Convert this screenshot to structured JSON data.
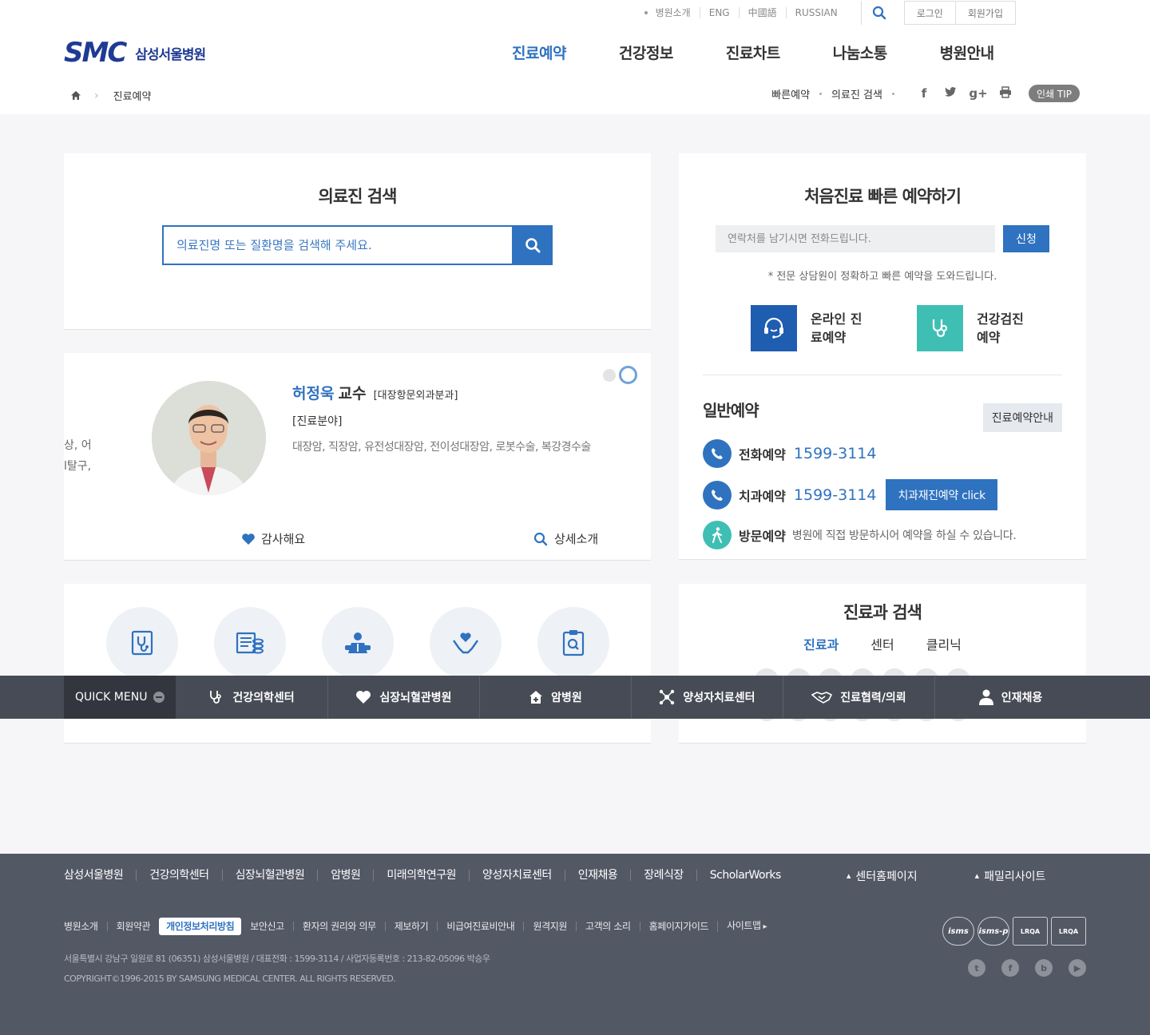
{
  "colors": {
    "accent": "#2f72c0",
    "navy": "#1f3b94",
    "teal": "#3fbfb4",
    "footer": "#535865",
    "quick": "#474b55"
  },
  "header": {
    "lang_links": [
      "병원소개",
      "ENG",
      "中國語",
      "RUSSIAN"
    ],
    "login": "로그인",
    "join": "회원가입",
    "logo_mark": "SMC",
    "logo_name": "삼성서울병원",
    "gnb": [
      "진료예약",
      "건강정보",
      "진료차트",
      "나눔소통",
      "병원안내"
    ],
    "breadcrumb_current": "진료예약",
    "subtools": {
      "quick_res": "빠른예약",
      "doc_search": "의료진 검색",
      "print_tip": "인쇄 TIP",
      "sns": [
        "f",
        "t",
        "g+"
      ]
    }
  },
  "doctor_search": {
    "title": "의료진 검색",
    "placeholder": "의료진명 또는 질환명을 검색해 주세요."
  },
  "doctor_card": {
    "prev_snippet": [
      "상, 어",
      "l탈구,"
    ],
    "name": "허정욱",
    "rank": "교수",
    "dept": "[대장항문외과분과]",
    "field_label": "[진료분야]",
    "specialty": "대장암, 직장암, 유전성대장암, 전이성대장암, 로봇수술, 복강경수술",
    "thanks": "감사해요",
    "detail": "상세소개"
  },
  "fast_reservation": {
    "title": "처음진료 빠른 예약하기",
    "phone_placeholder": "연락처를 남기시면 전화드립니다.",
    "apply": "신청",
    "note": "* 전문 상담원이 정확하고 빠른 예약을 도와드립니다.",
    "tiles": [
      {
        "label": "온라인 진료예약",
        "icon": "headset-icon",
        "color": "#1f5db0"
      },
      {
        "label": "건강검진 예약",
        "icon": "stethoscope-icon",
        "color": "#3fbfb4"
      }
    ],
    "general_title": "일반예약",
    "general_guide": "진료예약안내",
    "phone_res": {
      "label": "전화예약",
      "number": "1599-3114"
    },
    "dental_res": {
      "label": "치과예약",
      "number": "1599-3114",
      "button": "치과재진예약 click"
    },
    "visit_res": {
      "label": "방문예약",
      "desc": "병원에 직접 방문하시어 예약을 하실 수 있습니다."
    }
  },
  "icon_card": {
    "icons": [
      "stethoscope-icon",
      "receipt-icon",
      "patient-icon",
      "heart-hands-icon",
      "clipboard-search-icon"
    ]
  },
  "dept_search": {
    "title": "진료과 검색",
    "tabs": [
      "진료과",
      "센터",
      "클리닉"
    ]
  },
  "quick_menu": {
    "label": "QUICK MENU",
    "items": [
      "건강의학센터",
      "심장뇌혈관병원",
      "암병원",
      "양성자치료센터",
      "진료협력/의뢰",
      "인재채용"
    ]
  },
  "footer": {
    "links": [
      "삼성서울병원",
      "건강의학센터",
      "심장뇌혈관병원",
      "암병원",
      "미래의학연구원",
      "양성자치료센터",
      "인재채용",
      "장례식장",
      "ScholarWorks"
    ],
    "sites": [
      "센터홈페이지",
      "패밀리사이트"
    ],
    "links2": [
      "병원소개",
      "회원약관",
      "개인정보처리방침",
      "보안신고",
      "환자의 권리와 의무",
      "제보하기",
      "비급여진료비안내",
      "원격지원",
      "고객의 소리",
      "홈페이지가이드",
      "사이트맵"
    ],
    "address": "서울특별시 강남구 일원로 81 (06351) 삼성서울병원 / 대표전화 : 1599-3114 / 사업자등록번호 : 213-82-05096 박승우",
    "copyright": "COPYRIGHT©1996-2015 BY SAMSUNG MEDICAL CENTER. ALL RIGHTS RESERVED.",
    "certs": [
      "isms",
      "isms-p",
      "LRQA",
      "LRQA"
    ],
    "sns": [
      "t",
      "f",
      "b",
      "▶"
    ]
  }
}
